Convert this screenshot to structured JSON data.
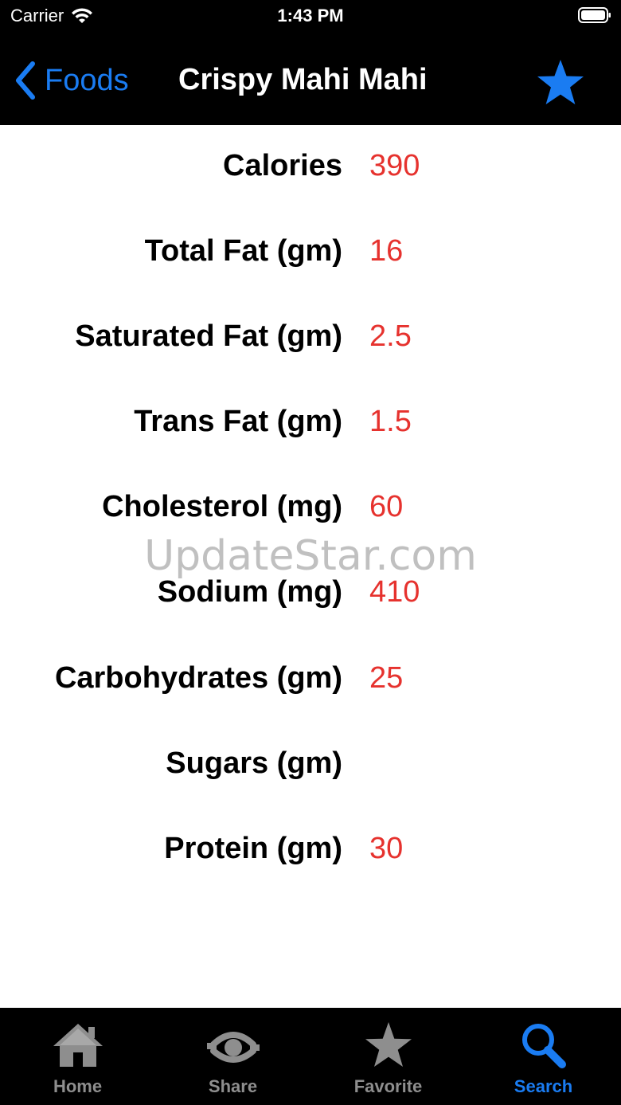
{
  "status_bar": {
    "carrier": "Carrier",
    "time": "1:43 PM",
    "wifi_icon": "wifi-icon",
    "battery_icon": "battery-icon"
  },
  "nav": {
    "back_label": "Foods",
    "title": "Crispy Mahi Mahi",
    "favorite_icon": "star-icon",
    "accent_color": "#1a7cf2"
  },
  "nutrition": [
    {
      "label": "Calories",
      "value": "390"
    },
    {
      "label": "Total Fat (gm)",
      "value": "16"
    },
    {
      "label": "Saturated Fat (gm)",
      "value": "2.5"
    },
    {
      "label": "Trans Fat (gm)",
      "value": "1.5"
    },
    {
      "label": "Cholesterol (mg)",
      "value": "60"
    },
    {
      "label": "Sodium (mg)",
      "value": "410"
    },
    {
      "label": "Carbohydrates (gm)",
      "value": "25"
    },
    {
      "label": "Sugars (gm)",
      "value": ""
    },
    {
      "label": "Protein (gm)",
      "value": "30"
    }
  ],
  "value_color": "#e6322e",
  "watermark": "UpdateStar.com",
  "tabs": [
    {
      "label": "Home",
      "icon": "home-icon",
      "active": false
    },
    {
      "label": "Share",
      "icon": "share-icon",
      "active": false
    },
    {
      "label": "Favorite",
      "icon": "star-icon",
      "active": false
    },
    {
      "label": "Search",
      "icon": "search-icon",
      "active": true
    }
  ]
}
